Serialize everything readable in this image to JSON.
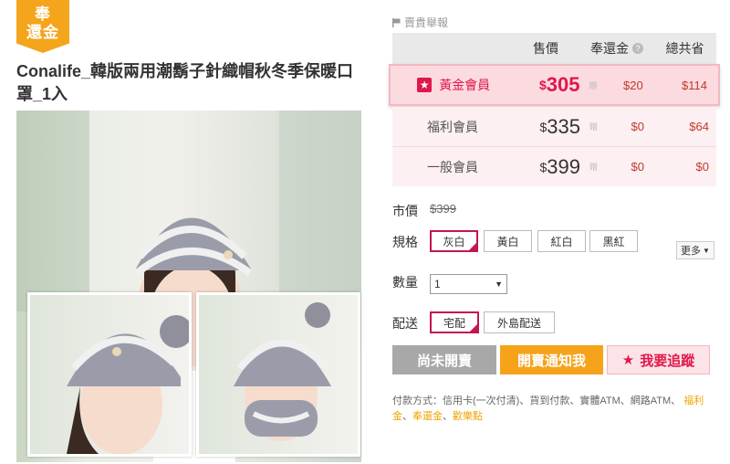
{
  "badge": {
    "line1": "奉",
    "line2": "還金"
  },
  "product": {
    "title": "Conalife_韓版兩用潮鬍子針織帽秋冬季保暖口罩_1入"
  },
  "report": {
    "label": "賣貴舉報"
  },
  "price_table": {
    "headers": {
      "price": "售價",
      "cashback": "奉還金",
      "total_save": "總共省"
    },
    "rows": [
      {
        "member": "黃金會員",
        "price": "305",
        "gift": "贈",
        "cashback": "$20",
        "save": "$114"
      },
      {
        "member": "福利會員",
        "price": "335",
        "gift": "贈",
        "cashback": "$0",
        "save": "$64"
      },
      {
        "member": "一般會員",
        "price": "399",
        "gift": "贈",
        "cashback": "$0",
        "save": "$0"
      }
    ],
    "currency": "$"
  },
  "market_price": {
    "label": "市價",
    "value": "$399"
  },
  "spec": {
    "label": "規格",
    "options": [
      "灰白",
      "黃白",
      "紅白",
      "黑紅"
    ],
    "more": "更多"
  },
  "quantity": {
    "label": "數量",
    "value": "1"
  },
  "delivery": {
    "label": "配送",
    "options": [
      "宅配",
      "外島配送"
    ]
  },
  "buttons": {
    "not_open": "尚未開賣",
    "notify": "開賣通知我",
    "track": "我要追蹤"
  },
  "payment": {
    "label": "付款方式：信用卡(一次付清)、貨到付款、實體ATM、網路ATM、",
    "highlight1": "福利金",
    "sep": "、",
    "highlight2": "奉還金",
    "highlight3": "歡樂點"
  },
  "colors": {
    "accent": "#e0174a",
    "orange": "#f6a31b",
    "badge": "#f5a51c"
  }
}
